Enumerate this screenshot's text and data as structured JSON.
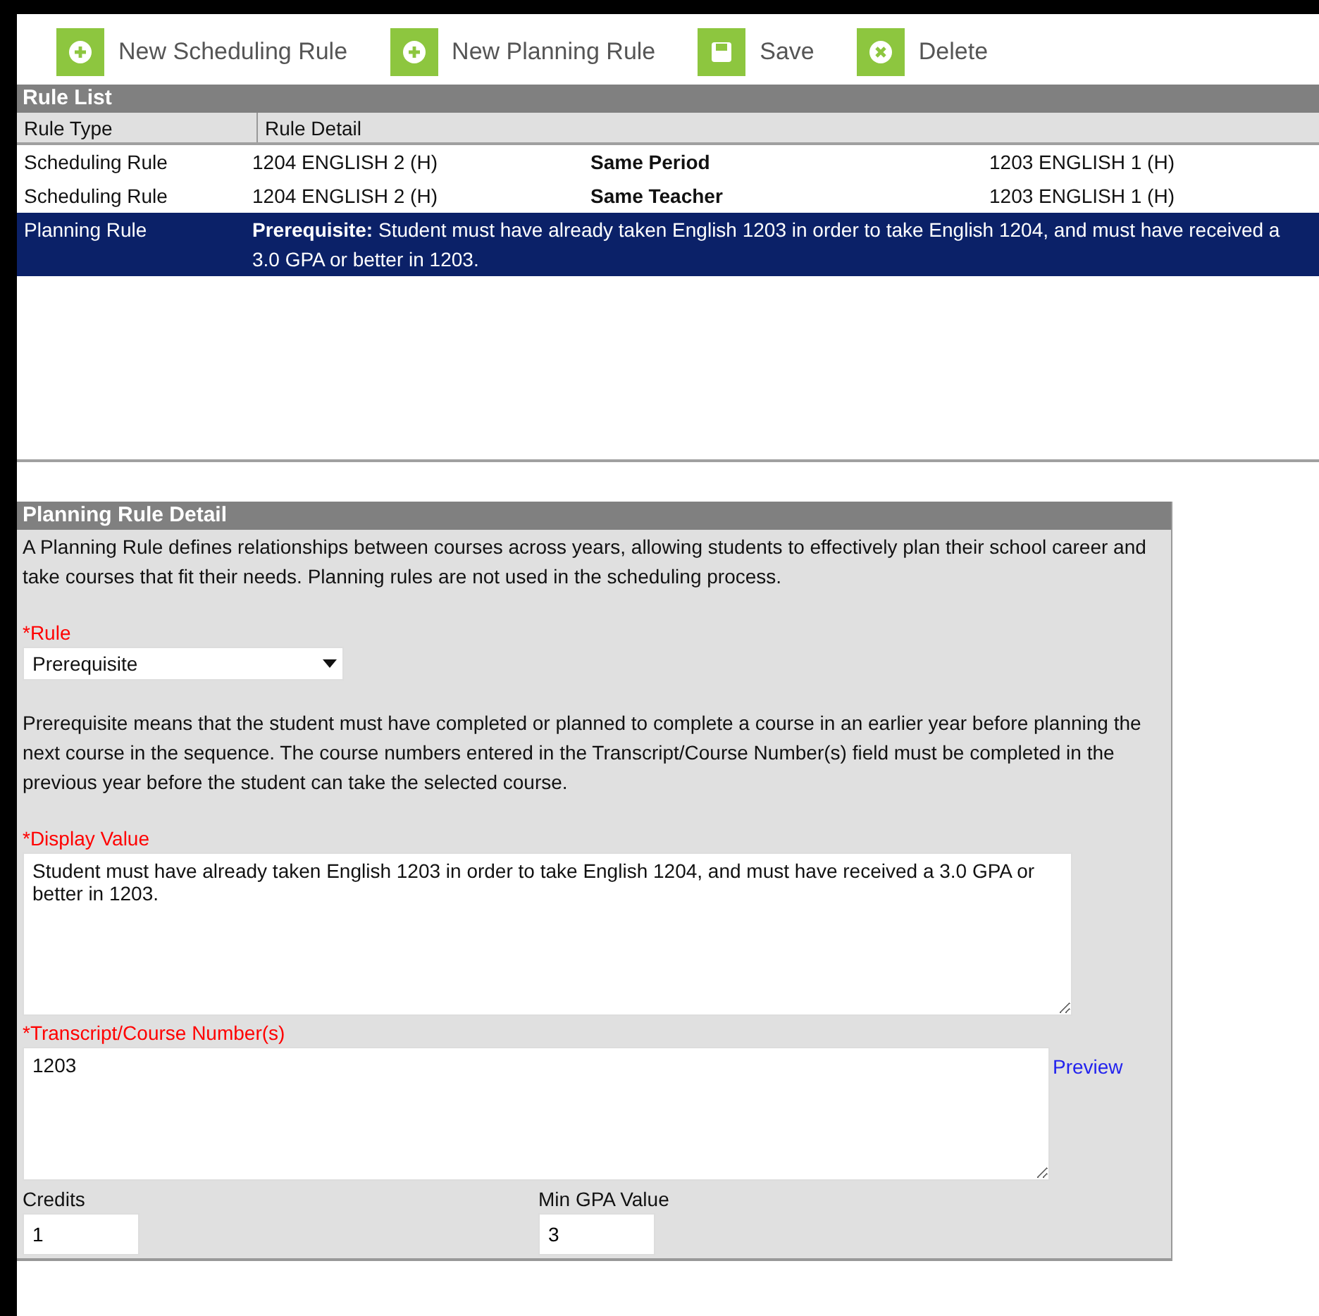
{
  "toolbar": [
    {
      "label": "New Scheduling Rule",
      "kind": "add"
    },
    {
      "label": "New Planning Rule",
      "kind": "add"
    },
    {
      "label": "Save",
      "kind": "save"
    },
    {
      "label": "Delete",
      "kind": "delete"
    }
  ],
  "rule_list": {
    "title": "Rule List",
    "columns": [
      "Rule Type",
      "Rule Detail"
    ],
    "rows": [
      {
        "kind": "scheduling",
        "selected": false,
        "type": "Scheduling Rule",
        "course": "1204 ENGLISH 2 (H)",
        "relation": "Same Period",
        "related_course": "1203 ENGLISH 1 (H)"
      },
      {
        "kind": "scheduling",
        "selected": false,
        "type": "Scheduling Rule",
        "course": "1204 ENGLISH 2 (H)",
        "relation": "Same Teacher",
        "related_course": "1203 ENGLISH 1 (H)"
      },
      {
        "kind": "planning",
        "selected": true,
        "type": "Planning Rule",
        "detail": "**Prerequisite:** Student must have already taken English 1203 in order to take English 1204, and must have received a 3.0 GPA or better in 1203."
      }
    ]
  },
  "detail": {
    "title": "Planning Rule Detail",
    "description": "A Planning Rule defines relationships between courses across years, allowing students to effectively plan their school career and take courses that fit their needs. Planning rules are not used in the scheduling process.",
    "rule": {
      "label": "*Rule",
      "value": "Prerequisite"
    },
    "rule_help": "Prerequisite means that the student must have completed or planned to complete a course in an earlier year before planning the next course in the sequence. The course numbers entered in the Transcript/Course Number(s) field must be completed in the previous year before the student can take the selected course.",
    "display_value": {
      "label": "*Display Value",
      "value": "Student must have already taken English 1203 in order to take English 1204, and must have received a 3.0 GPA or better in 1203."
    },
    "course_numbers": {
      "label": "*Transcript/Course Number(s)",
      "value": "1203",
      "link": "Preview"
    },
    "credits": {
      "label": "Credits",
      "value": "1"
    },
    "min_gpa": {
      "label": "Min GPA Value",
      "value": "3"
    }
  }
}
